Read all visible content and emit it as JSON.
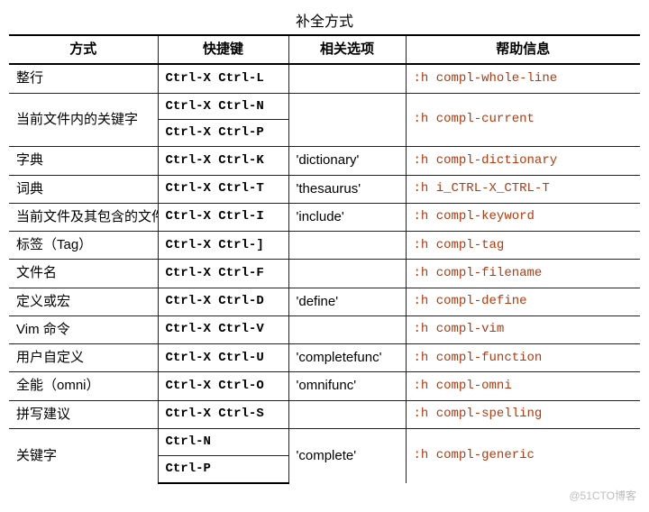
{
  "title": "补全方式",
  "columns": {
    "method": "方式",
    "shortcut": "快捷键",
    "option": "相关选项",
    "help": "帮助信息"
  },
  "watermark": "@51CTO博客",
  "rows": [
    {
      "method": "整行",
      "keys": [
        "Ctrl-X Ctrl-L"
      ],
      "option": "",
      "help": ":h compl-whole-line"
    },
    {
      "method": "当前文件内的关键字",
      "keys": [
        "Ctrl-X Ctrl-N",
        "Ctrl-X Ctrl-P"
      ],
      "option": "",
      "help": ":h compl-current"
    },
    {
      "method": "字典",
      "keys": [
        "Ctrl-X Ctrl-K"
      ],
      "option": "'dictionary'",
      "help": ":h compl-dictionary"
    },
    {
      "method": "词典",
      "keys": [
        "Ctrl-X Ctrl-T"
      ],
      "option": "'thesaurus'",
      "help": ":h i_CTRL-X_CTRL-T"
    },
    {
      "method": "当前文件及其包含的文件",
      "keys": [
        "Ctrl-X Ctrl-I"
      ],
      "option": "'include'",
      "help": ":h compl-keyword"
    },
    {
      "method": "标签（Tag）",
      "keys": [
        "Ctrl-X Ctrl-]"
      ],
      "option": "",
      "help": ":h compl-tag"
    },
    {
      "method": "文件名",
      "keys": [
        "Ctrl-X Ctrl-F"
      ],
      "option": "",
      "help": ":h compl-filename"
    },
    {
      "method": "定义或宏",
      "keys": [
        "Ctrl-X Ctrl-D"
      ],
      "option": "'define'",
      "help": ":h compl-define"
    },
    {
      "method": "Vim 命令",
      "keys": [
        "Ctrl-X Ctrl-V"
      ],
      "option": "",
      "help": ":h compl-vim"
    },
    {
      "method": "用户自定义",
      "keys": [
        "Ctrl-X Ctrl-U"
      ],
      "option": "'completefunc'",
      "help": ":h compl-function"
    },
    {
      "method": "全能（omni）",
      "keys": [
        "Ctrl-X Ctrl-O"
      ],
      "option": "'omnifunc'",
      "help": ":h compl-omni"
    },
    {
      "method": "拼写建议",
      "keys": [
        "Ctrl-X Ctrl-S"
      ],
      "option": "",
      "help": ":h compl-spelling"
    },
    {
      "method": "关键字",
      "keys": [
        "Ctrl-N",
        "Ctrl-P"
      ],
      "option": "'complete'",
      "help": ":h compl-generic"
    }
  ]
}
